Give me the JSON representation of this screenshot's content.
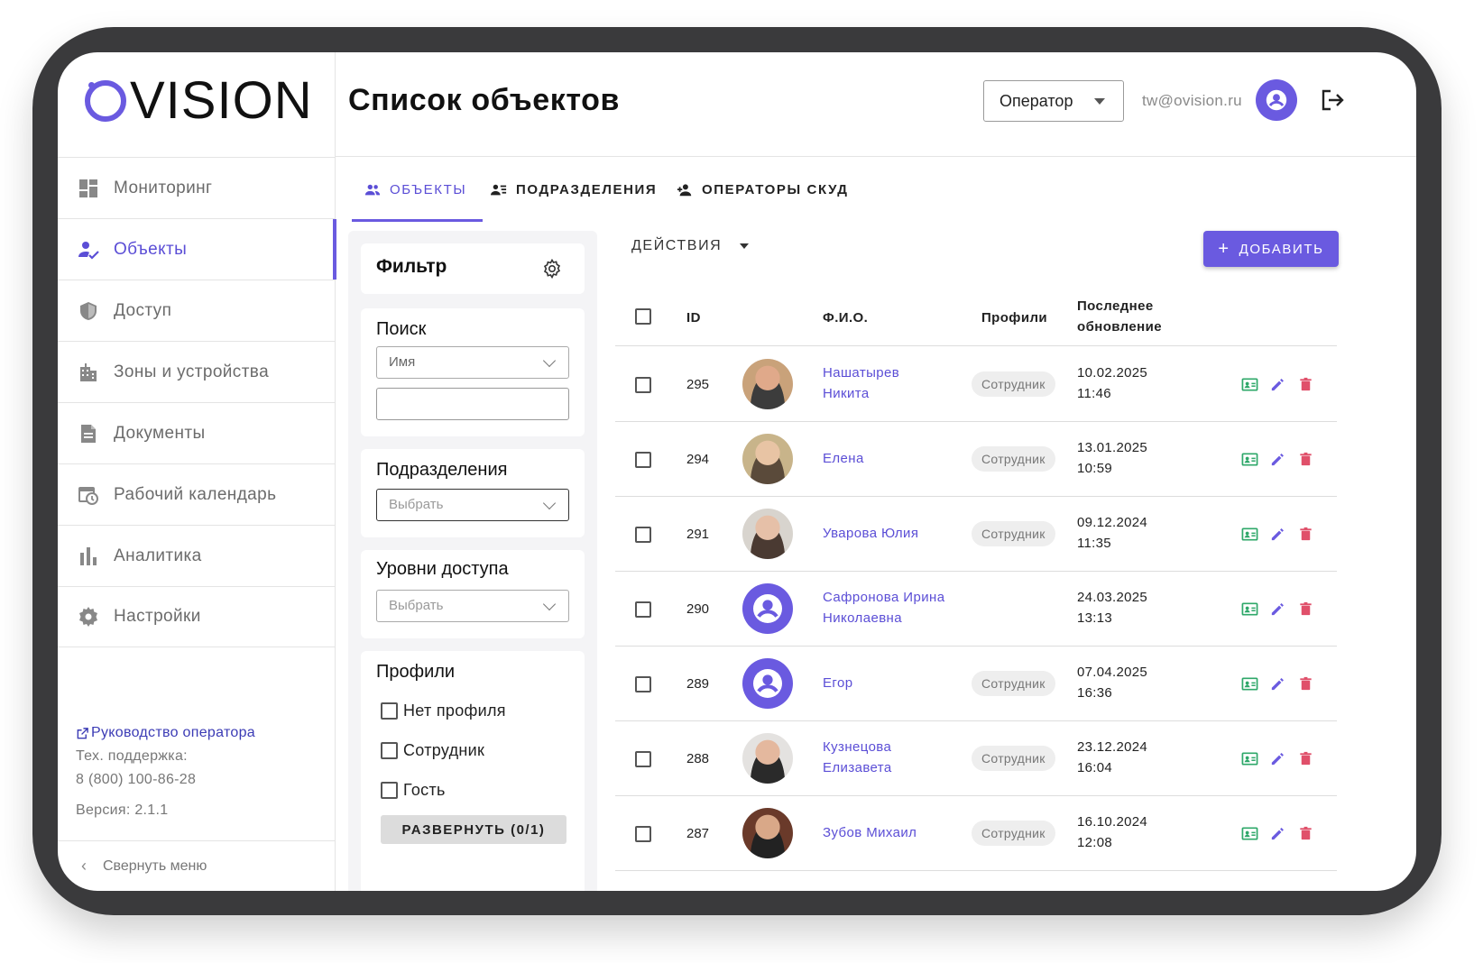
{
  "app": {
    "logo_text": "VISION",
    "logo_letter": "O",
    "brand_color": "#6a5ae0"
  },
  "sidebar": {
    "items": [
      {
        "label": "Мониторинг",
        "icon": "dashboard-icon",
        "active": false
      },
      {
        "label": "Объекты",
        "icon": "person-check-icon",
        "active": true
      },
      {
        "label": "Доступ",
        "icon": "shield-icon",
        "active": false
      },
      {
        "label": "Зоны и устройства",
        "icon": "building-icon",
        "active": false
      },
      {
        "label": "Документы",
        "icon": "document-icon",
        "active": false
      },
      {
        "label": "Рабочий календарь",
        "icon": "calendar-clock-icon",
        "active": false
      },
      {
        "label": "Аналитика",
        "icon": "bar-chart-icon",
        "active": false
      },
      {
        "label": "Настройки",
        "icon": "gear-icon",
        "active": false
      }
    ],
    "guide_link": "Руководство оператора",
    "support_label": "Тех. поддержка:",
    "support_phone": "8 (800) 100-86-28",
    "version": "Версия: 2.1.1",
    "collapse_label": "Свернуть меню"
  },
  "header": {
    "title": "Список объектов",
    "role_value": "Оператор",
    "email": "tw@ovision.ru"
  },
  "tabs": [
    {
      "label": "ОБЪЕКТЫ",
      "icon": "people-icon",
      "active": true
    },
    {
      "label": "ПОДРАЗДЕЛЕНИЯ",
      "icon": "list-person-icon",
      "active": false
    },
    {
      "label": "ОПЕРАТОРЫ СКУД",
      "icon": "person-add-icon",
      "active": false
    }
  ],
  "filter": {
    "title": "Фильтр",
    "search_label": "Поиск",
    "search_field_value": "Имя",
    "search_input_value": "",
    "departments_label": "Подразделения",
    "departments_placeholder": "Выбрать",
    "access_label": "Уровни доступа",
    "access_placeholder": "Выбрать",
    "profiles_label": "Профили",
    "profiles": [
      "Нет профиля",
      "Сотрудник",
      "Гость"
    ],
    "expand_label": "РАЗВЕРНУТЬ (0/1)"
  },
  "toolbar": {
    "actions_label": "ДЕЙСТВИЯ",
    "add_label": "ДОБАВИТЬ"
  },
  "table": {
    "columns": {
      "id": "ID",
      "name": "Ф.И.О.",
      "profiles": "Профили",
      "updated_1": "Последнее",
      "updated_2": "обновление"
    },
    "rows": [
      {
        "id": "295",
        "name_1": "Нашатырев",
        "name_2": "Никита",
        "profile": "Сотрудник",
        "date": "10.02.2025",
        "time": "11:46",
        "avatar": "photo",
        "bg": "#c9a27a",
        "skin": "#e0a98a",
        "cloth": "#3c3c3c"
      },
      {
        "id": "294",
        "name_1": "Елена",
        "name_2": "",
        "profile": "Сотрудник",
        "date": "13.01.2025",
        "time": "10:59",
        "avatar": "photo",
        "bg": "#c8b48a",
        "skin": "#e8c4a4",
        "cloth": "#5a4a3a"
      },
      {
        "id": "291",
        "name_1": "Уварова Юлия",
        "name_2": "",
        "profile": "Сотрудник",
        "date": "09.12.2024",
        "time": "11:35",
        "avatar": "photo",
        "bg": "#d8d4ce",
        "skin": "#e6c0a8",
        "cloth": "#4a3a32"
      },
      {
        "id": "290",
        "name_1": "Сафронова Ирина",
        "name_2": "Николаевна",
        "profile": "",
        "date": "24.03.2025",
        "time": "13:13",
        "avatar": "placeholder",
        "bg": "",
        "skin": "",
        "cloth": ""
      },
      {
        "id": "289",
        "name_1": "Егор",
        "name_2": "",
        "profile": "Сотрудник",
        "date": "07.04.2025",
        "time": "16:36",
        "avatar": "placeholder",
        "bg": "",
        "skin": "",
        "cloth": ""
      },
      {
        "id": "288",
        "name_1": "Кузнецова",
        "name_2": "Елизавета",
        "profile": "Сотрудник",
        "date": "23.12.2024",
        "time": "16:04",
        "avatar": "photo",
        "bg": "#e4e2e0",
        "skin": "#e4b89e",
        "cloth": "#2a2a2a"
      },
      {
        "id": "287",
        "name_1": "Зубов Михаил",
        "name_2": "",
        "profile": "Сотрудник",
        "date": "16.10.2024",
        "time": "12:08",
        "avatar": "photo",
        "bg": "#6a3a2a",
        "skin": "#d9a888",
        "cloth": "#222222"
      }
    ]
  },
  "colors": {
    "accent": "#6a5ae0",
    "link": "#5b4ed6",
    "card_icon": "#2fa86a",
    "edit_icon": "#6a5ae0",
    "delete_icon": "#e0506a"
  }
}
